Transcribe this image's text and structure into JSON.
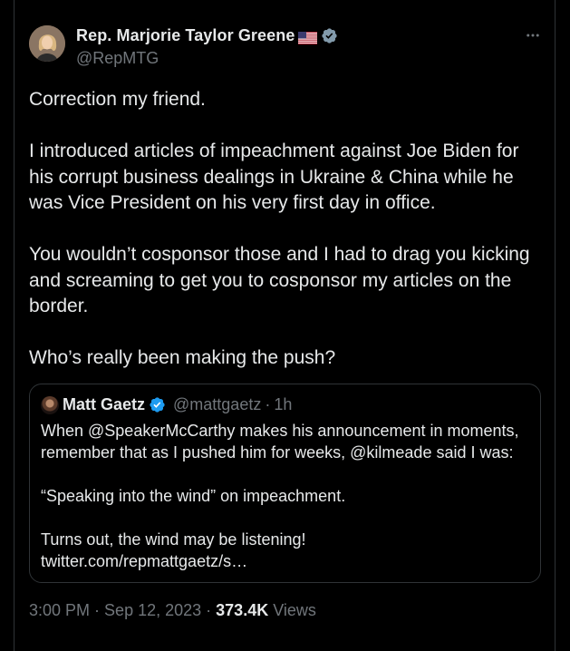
{
  "tweet": {
    "author_name": "Rep. Marjorie Taylor Greene",
    "author_flag_icon": "us-flag-icon",
    "author_badge_icon": "verified-gray-icon",
    "author_handle": "@RepMTG",
    "more_icon": "more-horizontal-icon",
    "text": "Correction my friend.\n\nI introduced articles of impeachment against Joe Biden for his corrupt business dealings in Ukraine & China while he was Vice President on his very first day in office.\n\nYou wouldn’t cosponsor those and I had to drag you kicking and screaming to get you to cosponsor my articles on the border.\n\nWho’s really been making the push?",
    "time": "3:00 PM",
    "date": "Sep 12, 2023",
    "views_count": "373.4K",
    "views_label": "Views",
    "separator": "·"
  },
  "quote": {
    "author_name": "Matt Gaetz",
    "author_badge_icon": "verified-blue-icon",
    "author_handle": "@mattgaetz",
    "separator": "·",
    "time": "1h",
    "text": "When @SpeakerMcCarthy makes his announcement in moments, remember that as I pushed him for weeks, @kilmeade said I was:\n\n“Speaking into the wind” on impeachment.\n\nTurns out, the wind may be listening!\ntwitter.com/repmattgaetz/s…"
  },
  "colors": {
    "background": "#000000",
    "text": "#e7e9ea",
    "secondary": "#71767b",
    "border": "#2f3336",
    "verified_blue": "#1d9bf0",
    "verified_gray": "#829aab"
  }
}
